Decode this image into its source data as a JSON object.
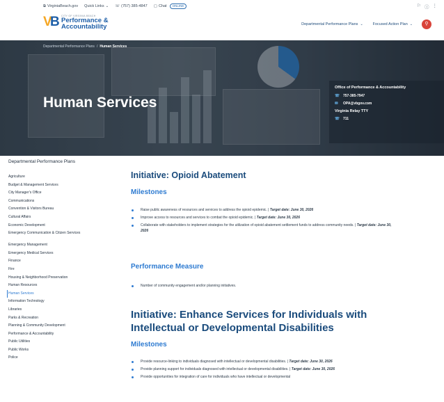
{
  "utility": {
    "site": "VirginiaBeach.gov",
    "quick_links": "Quick Links",
    "phone": "(757) 385-4847",
    "chat": "Chat",
    "chat_status": "ONLINE",
    "right_icons": [
      "accessibility-icon",
      "help-icon",
      "menu-icon"
    ]
  },
  "header": {
    "logo_small": "CITY OF VIRGINIA BEACH",
    "logo_line1": "Performance &",
    "logo_line2": "Accountability",
    "nav": [
      {
        "label": "Departmental Performance Plans"
      },
      {
        "label": "Focused Action Plan"
      }
    ]
  },
  "hero": {
    "breadcrumb_parent": "Departmental Performance Plans",
    "breadcrumb_current": "Human Services",
    "title": "Human Services",
    "contact": {
      "title": "Office of Performance & Accountability",
      "phone": "757-385-7947",
      "email": "OPA@vbgov.com",
      "relay_label": "Virginia Relay TTY",
      "relay_number": "711"
    }
  },
  "sidebar": {
    "heading": "Departmental Performance Plans",
    "items": [
      {
        "label": "Agriculture"
      },
      {
        "label": "Budget & Management Services"
      },
      {
        "label": "City Manager's Office"
      },
      {
        "label": "Communications"
      },
      {
        "label": "Convention & Visitors Bureau"
      },
      {
        "label": "Cultural Affairs"
      },
      {
        "label": "Economic Development"
      },
      {
        "label": "Emergency Communication & Citizen Services"
      },
      {
        "label": "Emergency Management"
      },
      {
        "label": "Emergency Medical Services"
      },
      {
        "label": "Finance"
      },
      {
        "label": "Fire"
      },
      {
        "label": "Housing & Neighborhood Preservation"
      },
      {
        "label": "Human Resources"
      },
      {
        "label": "Human Services"
      },
      {
        "label": "Information Technology"
      },
      {
        "label": "Libraries"
      },
      {
        "label": "Parks & Recreation"
      },
      {
        "label": "Planning & Community Development"
      },
      {
        "label": "Performance & Accountability"
      },
      {
        "label": "Public Utilities"
      },
      {
        "label": "Public Works"
      },
      {
        "label": "Police"
      }
    ]
  },
  "main": {
    "initiative1": {
      "title": "Initiative: Opioid Abatement",
      "milestones_heading": "Milestones",
      "milestones": [
        {
          "text": "Raise public awareness of resources and services to address the opioid epidemic. | ",
          "target": "Target date: June 30, 2026"
        },
        {
          "text": "Improve access to resources and services to combat the opioid epidemic. | ",
          "target": "Target date: June 30, 2026"
        },
        {
          "text": "Collaborate with stakeholders to implement strategies for the utilization of opioid abatement settlement funds to address community needs. | ",
          "target": "Target date: June 30, 2026"
        }
      ],
      "measure_heading": "Performance Measure",
      "measures": [
        {
          "text": "Number of community engagement and/or planning initiatives."
        }
      ]
    },
    "initiative2": {
      "title": "Initiative: Enhance Services for Individuals with Intellectual or Developmental Disabilities",
      "milestones_heading": "Milestones",
      "milestones": [
        {
          "text": "Provide resource-linking to individuals diagnosed with intellectual or developmental disabilities. | ",
          "target": "Target date: June 30, 2026"
        },
        {
          "text": "Provide planning support for individuals diagnosed with intellectual or developmental disabilities. | ",
          "target": "Target date: June 30, 2026"
        },
        {
          "text": "Provide opportunities for integration of care for individuals who have intellectual or developmental",
          "target": ""
        }
      ]
    }
  },
  "colors": {
    "brand_blue": "#1e5fa8",
    "accent_blue": "#2e7bd1",
    "heading_navy": "#1a4b7c",
    "logo_orange": "#f5a623",
    "search_red": "#d9443a"
  }
}
